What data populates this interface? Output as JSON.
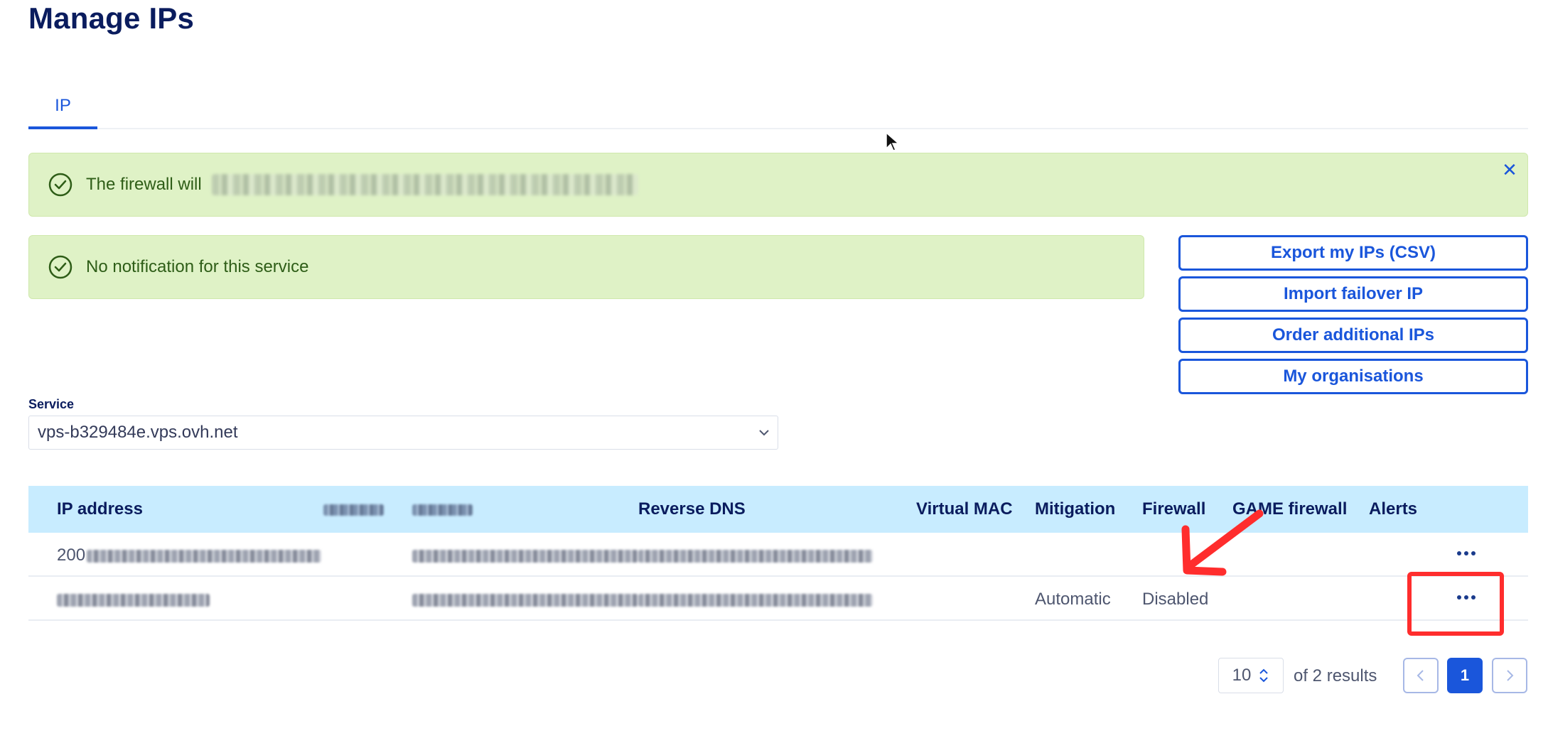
{
  "page": {
    "title": "Manage IPs"
  },
  "tabs": [
    {
      "label": "IP"
    }
  ],
  "alerts": {
    "firewall": {
      "text": "The firewall will"
    },
    "notification": {
      "text": "No notification for this service"
    }
  },
  "actions": {
    "export": "Export my IPs (CSV)",
    "import_failover": "Import failover IP",
    "order_ips": "Order additional IPs",
    "organisations": "My organisations"
  },
  "service": {
    "label": "Service",
    "selected": "vps-b329484e.vps.ovh.net"
  },
  "table": {
    "headers": {
      "ip_address": "IP address",
      "reverse_dns": "Reverse DNS",
      "virtual_mac": "Virtual MAC",
      "mitigation": "Mitigation",
      "firewall": "Firewall",
      "game_firewall": "GAME firewall",
      "alerts": "Alerts"
    },
    "rows": [
      {
        "ip_prefix": "200",
        "mitigation": "",
        "firewall": ""
      },
      {
        "ip_prefix": "",
        "mitigation": "Automatic",
        "firewall": "Disabled"
      }
    ]
  },
  "pagination": {
    "page_size": "10",
    "results": "of 2 results",
    "current_page": "1"
  },
  "colors": {
    "accent": "#1a56db",
    "success_bg": "#dff2c6",
    "table_header_bg": "#c8ecff",
    "annotation": "#ff2d2d"
  }
}
